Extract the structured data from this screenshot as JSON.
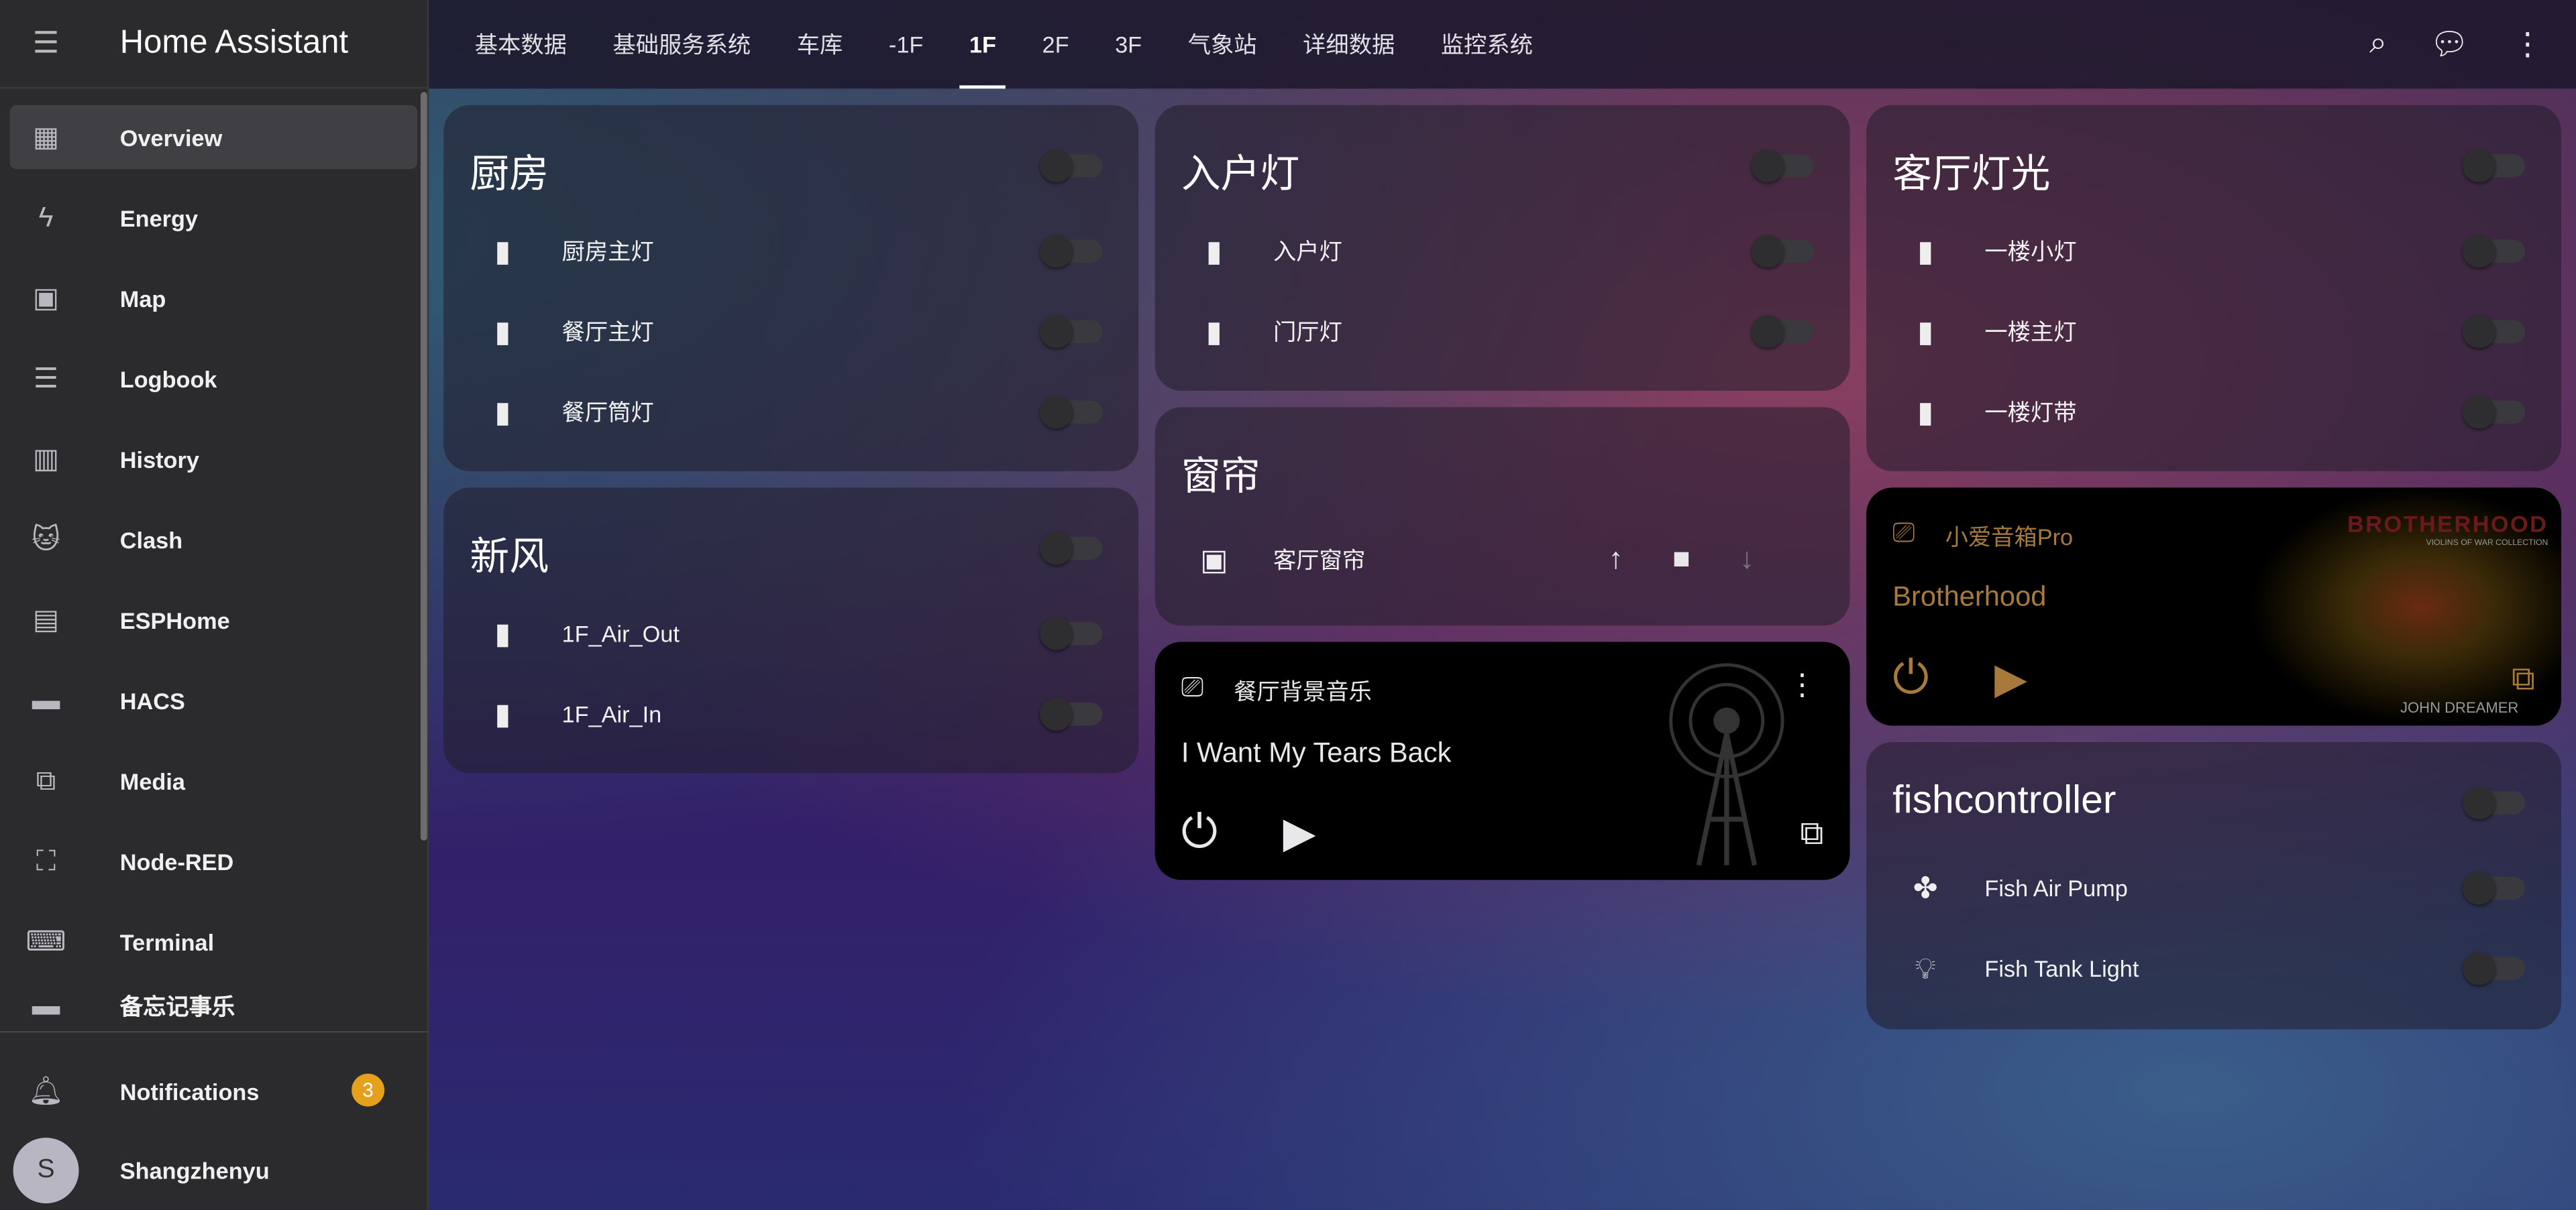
{
  "app": {
    "title": "Home Assistant"
  },
  "sidebar": {
    "items": [
      {
        "label": "Overview",
        "icon": "view-dashboard-icon",
        "selected": true
      },
      {
        "label": "Energy",
        "icon": "lightning-bolt-icon"
      },
      {
        "label": "Map",
        "icon": "map-account-icon"
      },
      {
        "label": "Logbook",
        "icon": "format-list-icon"
      },
      {
        "label": "History",
        "icon": "chart-box-icon"
      },
      {
        "label": "Clash",
        "icon": "cat-icon"
      },
      {
        "label": "ESPHome",
        "icon": "chip-icon"
      },
      {
        "label": "HACS",
        "icon": "hacs-icon"
      },
      {
        "label": "Media",
        "icon": "play-box-multiple-icon"
      },
      {
        "label": "Node-RED",
        "icon": "sitemap-icon"
      },
      {
        "label": "Terminal",
        "icon": "console-icon"
      },
      {
        "label": "备忘记事乐",
        "icon": "note-icon"
      }
    ],
    "notifications": {
      "label": "Notifications",
      "count": "3"
    },
    "user": {
      "name": "Shangzhenyu",
      "initial": "S"
    }
  },
  "tabs": [
    "基本数据",
    "基础服务系统",
    "车库",
    "-1F",
    "1F",
    "2F",
    "3F",
    "气象站",
    "详细数据",
    "监控系统"
  ],
  "active_tab": "1F",
  "cards": {
    "kitchen": {
      "title": "厨房",
      "items": [
        "厨房主灯",
        "餐厅主灯",
        "餐厅筒灯"
      ]
    },
    "fresh_air": {
      "title": "新风",
      "items": [
        "1F_Air_Out",
        "1F_Air_In"
      ]
    },
    "entry": {
      "title": "入户灯",
      "items": [
        "入户灯",
        "门厅灯"
      ]
    },
    "curtain": {
      "title": "窗帘",
      "item": "客厅窗帘"
    },
    "music1": {
      "device": "餐厅背景音乐",
      "track": "I Want My Tears Back"
    },
    "living": {
      "title": "客厅灯光",
      "items": [
        "一楼小灯",
        "一楼主灯",
        "一楼灯带"
      ]
    },
    "music2": {
      "device": "小爱音箱Pro",
      "track": "Brotherhood",
      "art_text": "BROTHERHOOD",
      "art_sub": "VIOLINS OF WAR COLLECTION",
      "art_artist": "JOHN DREAMER",
      "accent": "#a77a3c"
    },
    "fish": {
      "title": "fishcontroller",
      "items": [
        {
          "name": "Fish Air Pump",
          "icon": "fan-icon"
        },
        {
          "name": "Fish Tank Light",
          "icon": "lightbulb-icon"
        }
      ]
    }
  }
}
